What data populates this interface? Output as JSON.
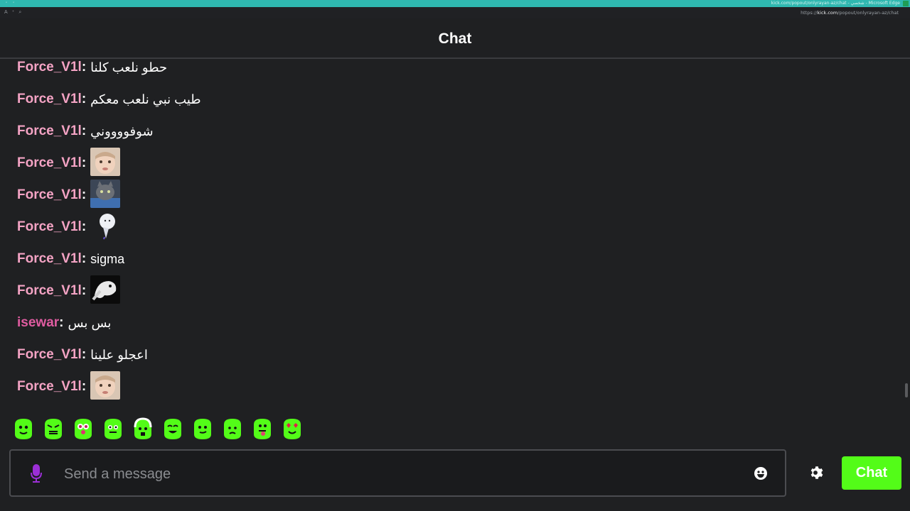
{
  "browser": {
    "window_title": "kick.com/popout/onlyrayan-az/chat - ‏شخصي - Microsoft Edge",
    "url_prefix": "https://",
    "url_domain": "kick.com",
    "url_path": "/popout/onlyrayan-az/chat"
  },
  "header": {
    "title": "Chat"
  },
  "colors": {
    "accent": "#53fc18",
    "username_force": "#f4a3c4",
    "username_isewar": "#e05ca1",
    "background": "#1f2022"
  },
  "messages": [
    {
      "username": "Force_V1l",
      "separator": ":",
      "text": "حطو نلعب كلنا",
      "type": "text",
      "user_color": "#f4a3c4"
    },
    {
      "username": "Force_V1l",
      "separator": ":",
      "text": "طيب نبي نلعب معكم",
      "type": "text",
      "user_color": "#f4a3c4"
    },
    {
      "username": "Force_V1l",
      "separator": ":",
      "text": "شوفووووني",
      "type": "text",
      "user_color": "#f4a3c4"
    },
    {
      "username": "Force_V1l",
      "separator": ":",
      "emote": "baby-face-emote",
      "type": "emote",
      "user_color": "#f4a3c4"
    },
    {
      "username": "Force_V1l",
      "separator": ":",
      "emote": "cat-emote",
      "type": "emote",
      "user_color": "#f4a3c4"
    },
    {
      "username": "Force_V1l",
      "separator": ":",
      "emote": "ghost-figure-emote",
      "type": "emote",
      "user_color": "#f4a3c4"
    },
    {
      "username": "Force_V1l",
      "separator": ":",
      "text": "sigma",
      "type": "text",
      "user_color": "#f4a3c4"
    },
    {
      "username": "Force_V1l",
      "separator": ":",
      "emote": "dog-emote",
      "type": "emote",
      "user_color": "#f4a3c4"
    },
    {
      "username": "isewar",
      "separator": ":",
      "text": "بس بس",
      "type": "text",
      "user_color": "#e05ca1"
    },
    {
      "username": "Force_V1l",
      "separator": ":",
      "text": "اعجلو علينا",
      "type": "text",
      "user_color": "#f4a3c4"
    },
    {
      "username": "Force_V1l",
      "separator": ":",
      "emote": "baby-face-emote",
      "type": "emote",
      "user_color": "#f4a3c4"
    }
  ],
  "quick_emotes": [
    "kick-emote-smile",
    "kick-emote-angry",
    "kick-emote-clown",
    "kick-emote-grin",
    "kick-emote-headphones",
    "kick-emote-happy",
    "kick-emote-smirk",
    "kick-emote-sad",
    "kick-emote-tongue",
    "kick-emote-love"
  ],
  "composer": {
    "placeholder": "Send a message",
    "mic_icon": "microphone-icon",
    "emoji_icon": "smiley-icon",
    "settings_icon": "gear-icon",
    "send_label": "Chat"
  }
}
